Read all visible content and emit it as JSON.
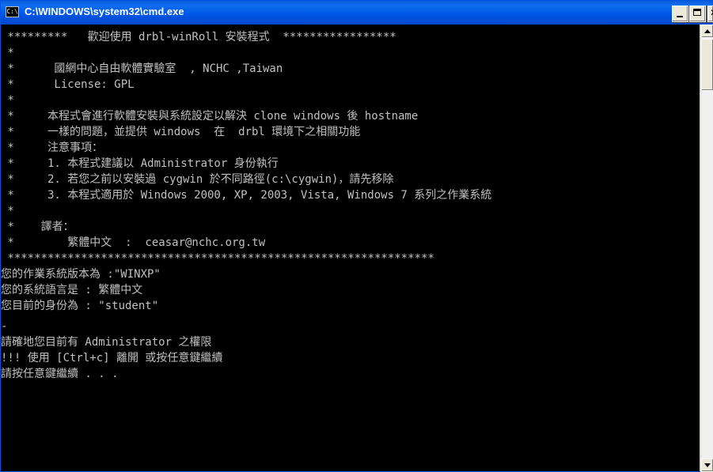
{
  "window": {
    "title": "C:\\WINDOWS\\system32\\cmd.exe",
    "icon": "cmd-console-icon",
    "icon_label": "C:\\"
  },
  "console": {
    "text_color": "#c0c0c0",
    "background_color": "#000000",
    "lines": [
      " *********   歡迎使用 drbl-winRoll 安裝程式  *****************",
      " *",
      " *      國網中心自由軟體實驗室  , NCHC ,Taiwan",
      " *      License: GPL",
      " *",
      " *     本程式會進行軟體安裝與系統設定以解決 clone windows 後 hostname",
      " *     一樣的問題，並提供 windows  在  drbl 環境下之相關功能",
      " *     注意事項：",
      " *     1. 本程式建議以 Administrator 身份執行",
      " *     2. 若您之前以安裝過 cygwin 於不同路徑(c:\\cygwin)，請先移除",
      " *     3. 本程式適用於 Windows 2000, XP, 2003, Vista, Windows 7 系列之作業系統",
      " *",
      " *    譯者：",
      " *        繁體中文  :  ceasar@nchc.org.tw",
      " ****************************************************************",
      "您的作業系統版本為 :\"WINXP\"",
      "您的系統語言是 : 繁體中文",
      "您目前的身份為 : \"student\"",
      "-",
      "請確地您目前有 Administrator 之權限",
      "!!! 使用 [Ctrl+c] 離開 或按任意鍵繼續",
      "請按任意鍵繼續 . . ."
    ]
  }
}
